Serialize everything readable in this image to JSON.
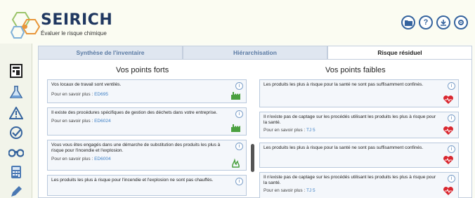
{
  "header": {
    "brand": "SEIRICH",
    "tagline": "Évaluer le risque chimique",
    "buttons": [
      "folder-icon",
      "help-icon",
      "download-icon",
      "settings-icon"
    ]
  },
  "sidebar": {
    "icons": [
      "inventory-icon",
      "flask-icon",
      "warning-icon",
      "check-icon",
      "binoculars-icon",
      "calculator-icon",
      "edit-icon"
    ]
  },
  "tabs": [
    {
      "label": "Synthèse de l'inventaire"
    },
    {
      "label": "Hiérarchisation"
    },
    {
      "label": "Risque résiduel"
    }
  ],
  "strengths": {
    "title": "Vos points forts",
    "cards": [
      {
        "text": "Vos locaux de travail sont ventilés.",
        "more": "Pour en savoir plus :",
        "link": "ED695",
        "icon": "factory-icon"
      },
      {
        "text": "Il existe des procédures spécifiques de gestion des déchets dans votre entreprise.",
        "more": "Pour en savoir plus :",
        "link": "ED6024",
        "icon": "factory-icon"
      },
      {
        "text": "Vous vous êtes engagés dans une démarche de substitution des produits les plus à risque pour l'incendie et l'explosion.",
        "more": "Pour en savoir plus :",
        "link": "ED6004",
        "icon": "fire-icon"
      },
      {
        "text": "Les produits les plus à risque pour l'incendie et l'explosion ne sont pas chauffés.",
        "more": "",
        "link": "",
        "icon": ""
      }
    ]
  },
  "weaknesses": {
    "title": "Vos points faibles",
    "cards": [
      {
        "text": "Les produits les plus à risque pour la santé ne sont pas suffisamment confinés.",
        "more": "",
        "link": "",
        "icon": "heart-icon"
      },
      {
        "text": "Il n'existe pas de captage sur les procédés utilisant les produits les plus à risque pour la santé.",
        "more": "Pour en savoir plus :",
        "link": "TJ 5",
        "icon": "heart-icon"
      },
      {
        "text": "Les produits les plus à risque pour la santé ne sont pas suffisamment confinés.",
        "more": "",
        "link": "",
        "icon": "heart-icon"
      },
      {
        "text": "Il n'existe pas de captage sur les procédés utilisant les produits les plus à risque pour la santé.",
        "more": "Pour en savoir plus :",
        "link": "TJ 5",
        "icon": "heart-icon"
      }
    ]
  },
  "colors": {
    "accent": "#36649e",
    "link": "#3d7fc4",
    "heart": "#d9262e",
    "factory": "#4aa03f"
  }
}
